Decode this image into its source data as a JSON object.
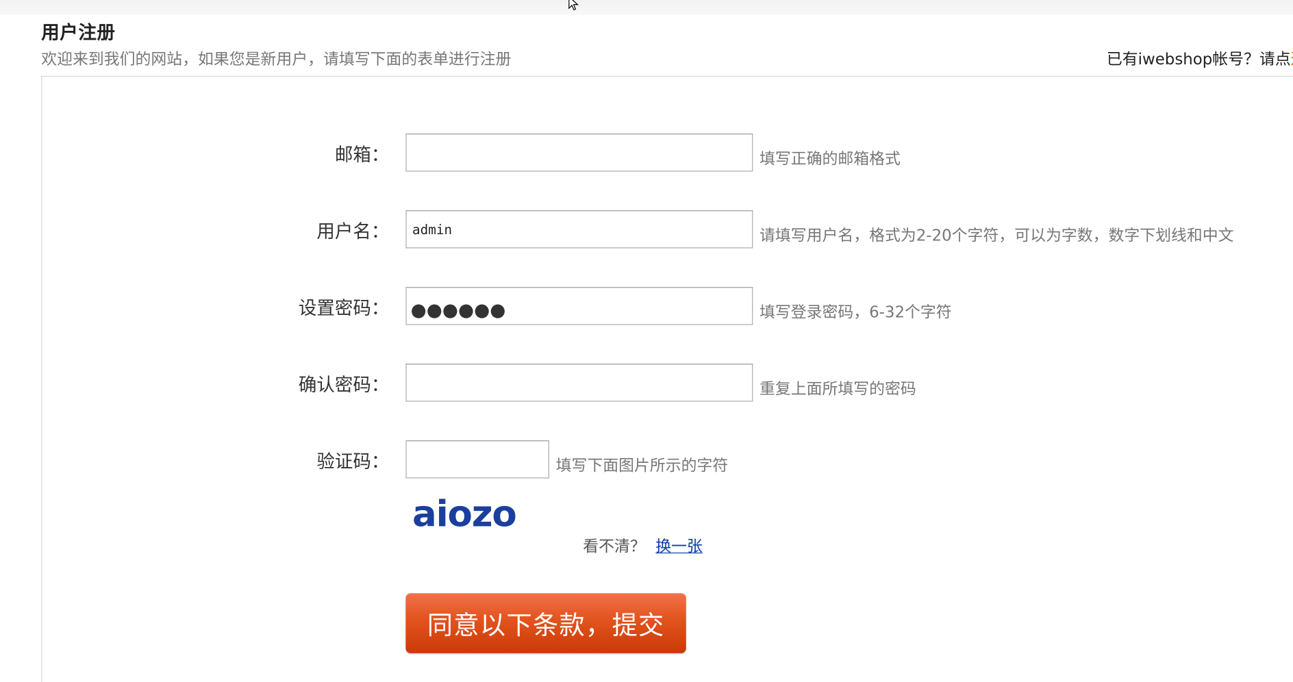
{
  "header": {
    "title": "用户注册",
    "subtitle": "欢迎来到我们的网站，如果您是新用户，请填写下面的表单进行注册",
    "login_prompt": "已有iwebshop帐号？请点",
    "login_link": "这"
  },
  "form": {
    "email": {
      "label": "邮箱：",
      "value": "",
      "hint": "填写正确的邮箱格式"
    },
    "username": {
      "label": "用户名：",
      "value": "admin",
      "hint": "请填写用户名，格式为2-20个字符，可以为字数，数字下划线和中文"
    },
    "password": {
      "label": "设置密码：",
      "masked_value": "●●●●●●",
      "hint": "填写登录密码，6-32个字符"
    },
    "confirm_password": {
      "label": "确认密码：",
      "value": "",
      "hint": "重复上面所填写的密码"
    },
    "captcha": {
      "label": "验证码：",
      "value": "",
      "hint": "填写下面图片所示的字符",
      "image_text": "aiozo",
      "image_color": "#1a3f9c",
      "refresh_prompt": "看不清？",
      "refresh_link": "换一张"
    },
    "submit_label": "同意以下条款，提交"
  },
  "colors": {
    "accent": "#e2531d",
    "link": "#0b3fa8",
    "hint_text": "#777777"
  },
  "icons": {
    "cursor": "mouse-pointer-icon"
  }
}
